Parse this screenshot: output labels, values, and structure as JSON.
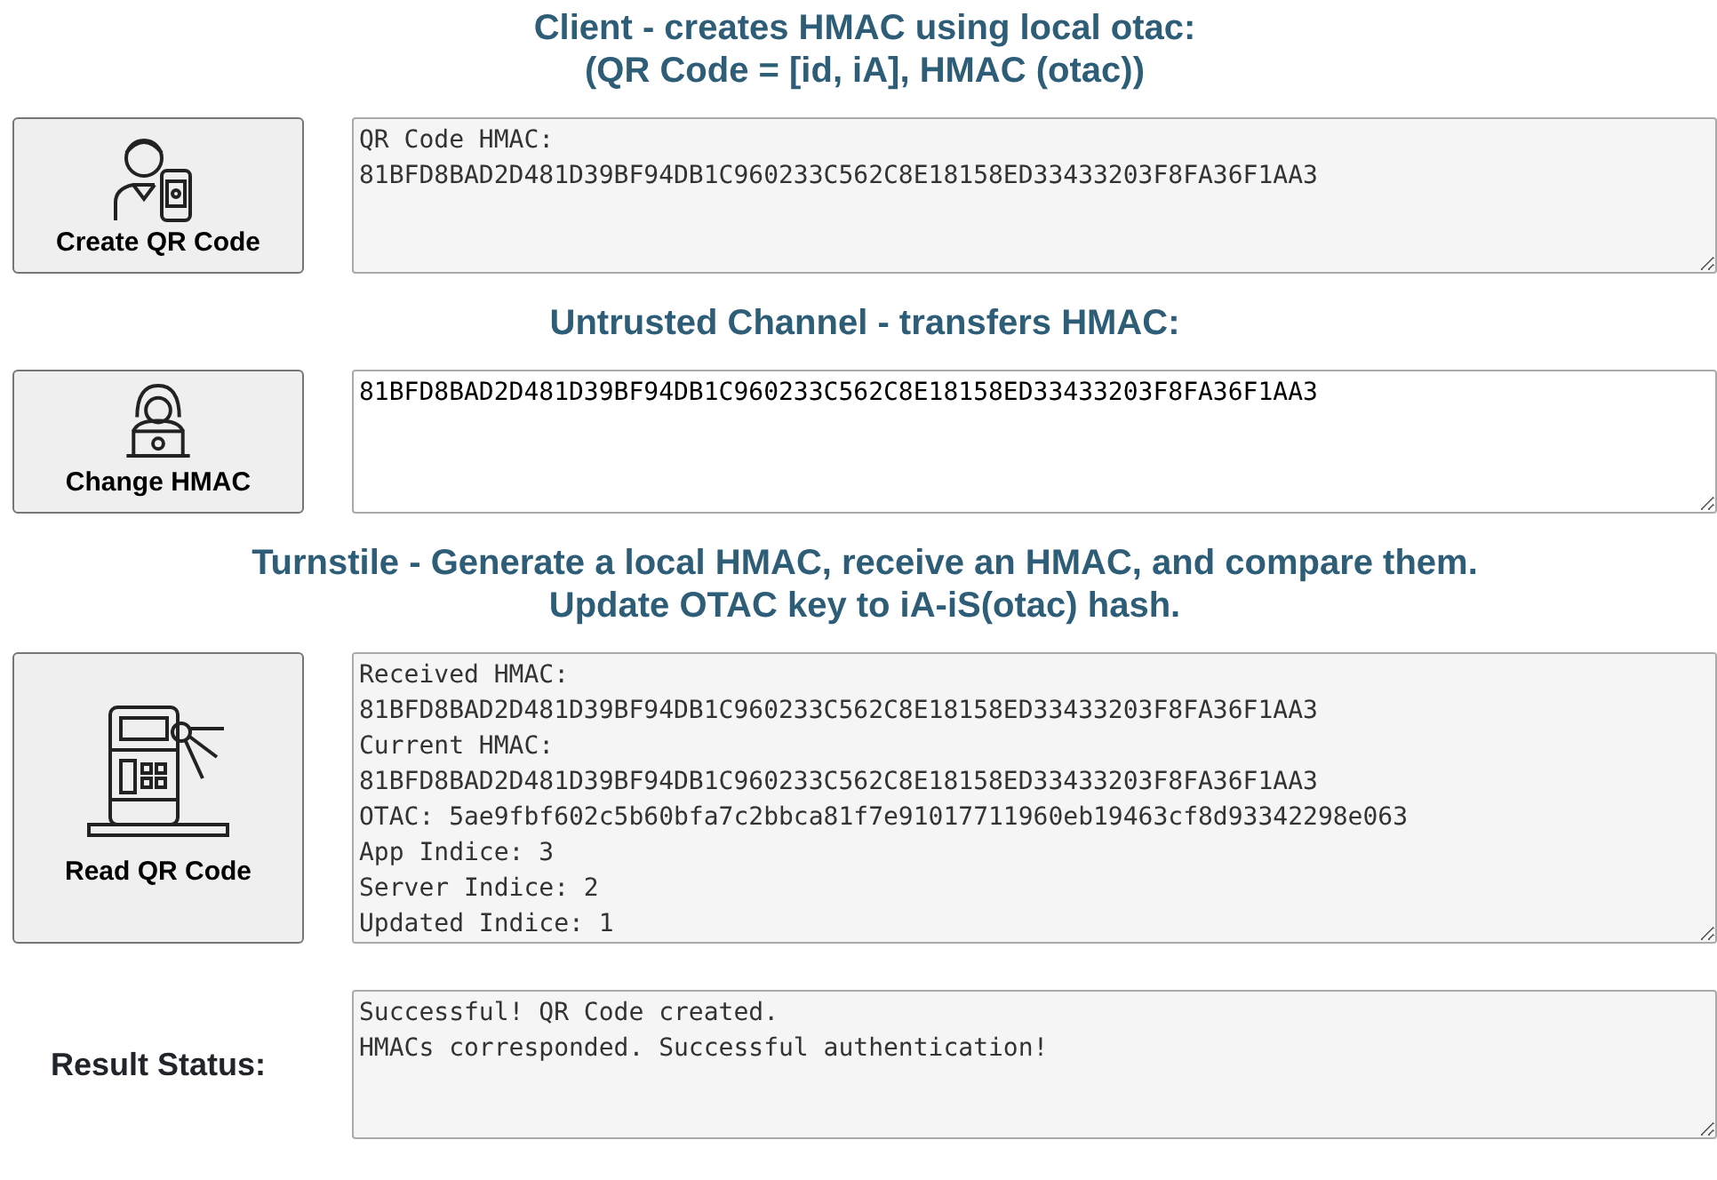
{
  "sections": [
    {
      "heading": [
        "Client - creates HMAC using local otac:",
        "(QR Code = [id, iA], HMAC (otac))"
      ],
      "button": {
        "label": "Create QR Code",
        "kind": "client"
      },
      "field": {
        "editable": false,
        "lines": [
          "QR Code HMAC:",
          "81BFD8BAD2D481D39BF94DB1C960233C562C8E18158ED33433203F8FA36F1AA3"
        ]
      }
    },
    {
      "heading": [
        "Untrusted Channel - transfers HMAC:"
      ],
      "button": {
        "label": "Change HMAC",
        "kind": "channel"
      },
      "field": {
        "editable": true,
        "lines": [
          "81BFD8BAD2D481D39BF94DB1C960233C562C8E18158ED33433203F8FA36F1AA3"
        ]
      }
    },
    {
      "heading": [
        "Turnstile - Generate a local HMAC, receive an HMAC, and compare them.",
        "Update OTAC key to iA-iS(otac) hash."
      ],
      "button": {
        "label": "Read QR Code",
        "kind": "turnstile"
      },
      "field": {
        "editable": false,
        "lines": [
          "Received HMAC:",
          "81BFD8BAD2D481D39BF94DB1C960233C562C8E18158ED33433203F8FA36F1AA3",
          "Current HMAC:",
          "81BFD8BAD2D481D39BF94DB1C960233C562C8E18158ED33433203F8FA36F1AA3",
          "OTAC: 5ae9fbf602c5b60bfa7c2bbca81f7e91017711960eb19463cf8d93342298e063",
          "App Indice: 3",
          "Server Indice: 2",
          "Updated Indice: 1"
        ]
      }
    }
  ],
  "result": {
    "label": "Result Status:",
    "field": {
      "editable": false,
      "lines": [
        "Successful! QR Code created.",
        "HMACs corresponded. Successful authentication!"
      ]
    }
  }
}
